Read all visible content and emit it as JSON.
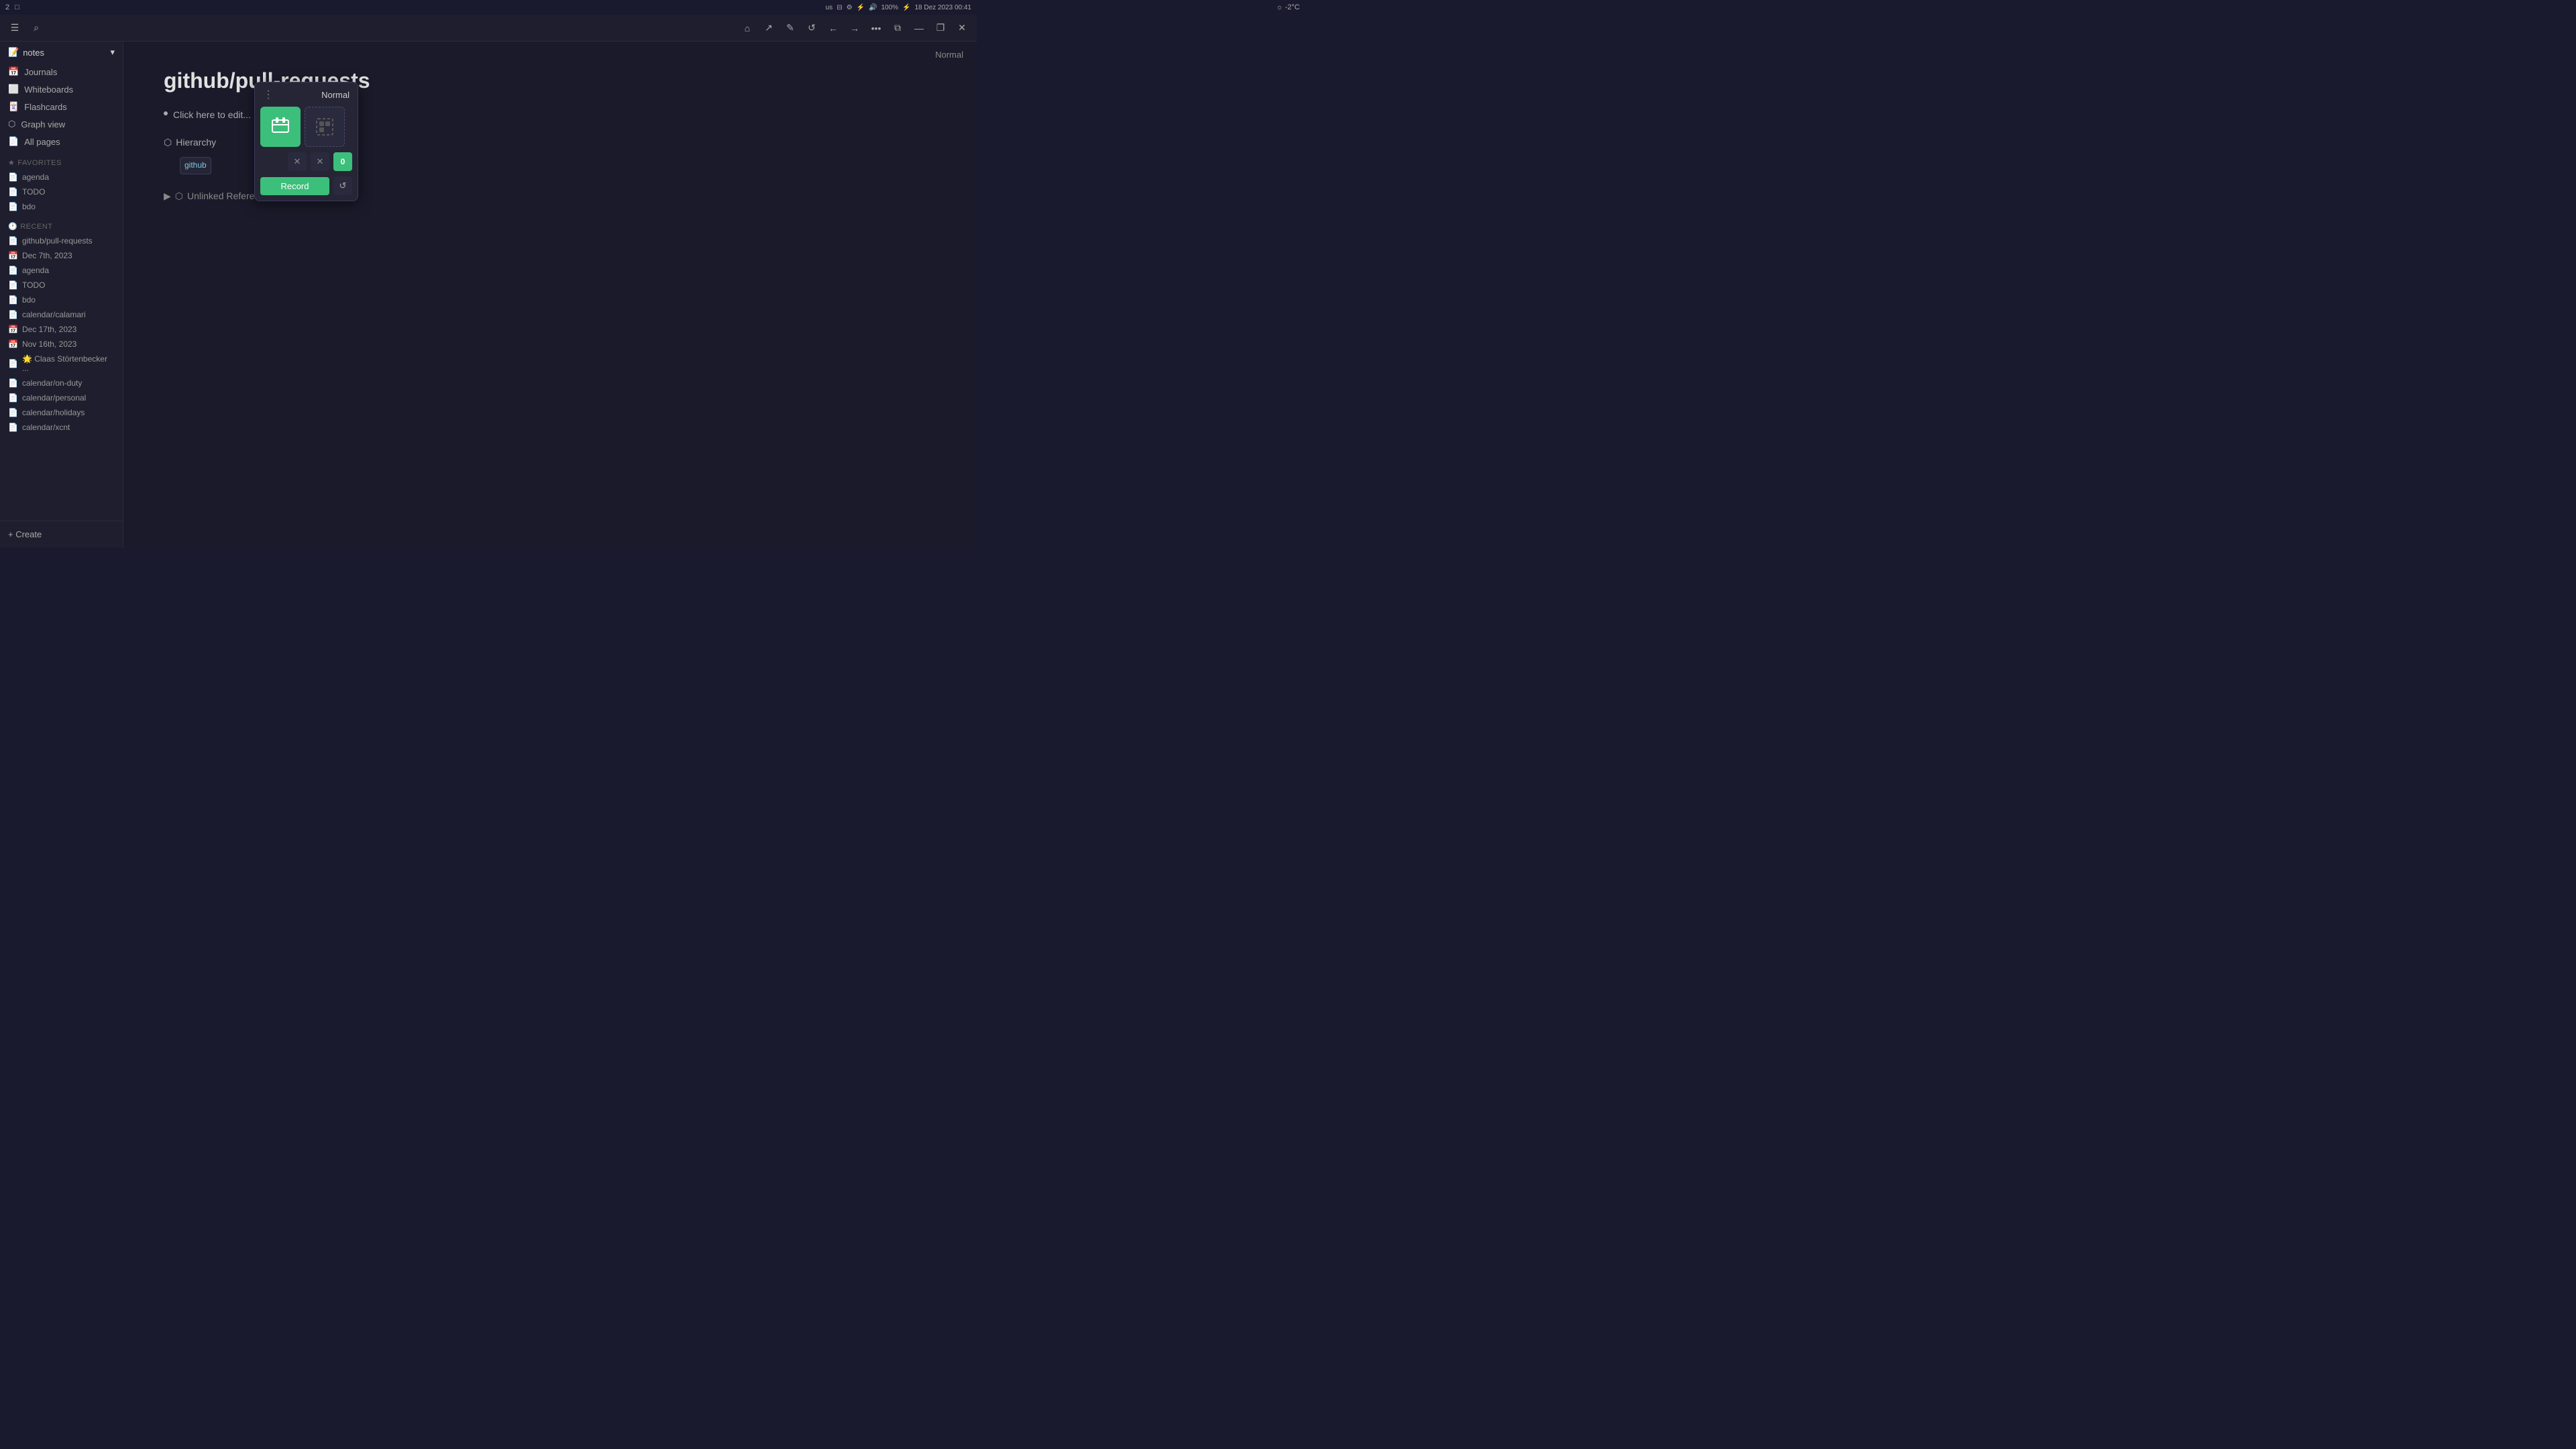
{
  "system_bar": {
    "workspace_num": "2",
    "weather": "☼ -2°C",
    "time": "18 Dez 2023  00:41",
    "lang": "us",
    "volume": "100%"
  },
  "toolbar": {
    "menu_icon": "☰",
    "search_icon": "🔍",
    "nav_buttons": [
      "⌂",
      "↗",
      "✏",
      "↺",
      "←",
      "→",
      "•••",
      "⧉"
    ],
    "window_controls": [
      "—",
      "❐",
      "✕"
    ]
  },
  "sidebar": {
    "workspace_label": "notes",
    "nav_items": [
      {
        "label": "Journals",
        "icon": "📅"
      },
      {
        "label": "Whiteboards",
        "icon": "⬜"
      },
      {
        "label": "Flashcards",
        "icon": "🃏"
      },
      {
        "label": "Graph view",
        "icon": "⬡"
      },
      {
        "label": "All pages",
        "icon": "📄"
      }
    ],
    "favorites_label": "FAVORITES",
    "favorites_icon": "★",
    "favorites": [
      {
        "label": "agenda",
        "icon": "📄"
      },
      {
        "label": "TODO",
        "icon": "📄"
      },
      {
        "label": "bdo",
        "icon": "📄"
      }
    ],
    "recent_label": "RECENT",
    "recent_icon": "🕐",
    "recent": [
      {
        "label": "github/pull-requests",
        "icon": "📄"
      },
      {
        "label": "Dec 7th, 2023",
        "icon": "📅"
      },
      {
        "label": "agenda",
        "icon": "📄"
      },
      {
        "label": "TODO",
        "icon": "📄"
      },
      {
        "label": "bdo",
        "icon": "📄"
      },
      {
        "label": "calendar/calamari",
        "icon": "📄"
      },
      {
        "label": "Dec 17th, 2023",
        "icon": "📅"
      },
      {
        "label": "Nov 16th, 2023",
        "icon": "📅"
      },
      {
        "label": "🌟 Claas Störtenbecker ...",
        "icon": "📄"
      },
      {
        "label": "calendar/on-duty",
        "icon": "📄"
      },
      {
        "label": "calendar/personal",
        "icon": "📄"
      },
      {
        "label": "calendar/holidays",
        "icon": "📄"
      },
      {
        "label": "calendar/xcnt",
        "icon": "📄"
      }
    ],
    "create_label": "+ Create"
  },
  "popup": {
    "title": "Normal",
    "more_icon": "⋮",
    "icon1_symbol": "⊞",
    "icon2_symbol": "⊟",
    "tool1_symbol": "✕",
    "tool2_symbol": "✕",
    "count": "0",
    "record_label": "Record",
    "refresh_icon": "↺"
  },
  "main": {
    "page_title": "github/pull-requests",
    "normal_badge": "Normal",
    "edit_placeholder": "Click here to edit...",
    "hierarchy_label": "Hierarchy",
    "hierarchy_icon": "⬡",
    "hierarchy_link": "github",
    "unlinked_refs_label": "Unlinked References",
    "unlinked_refs_icon": "⬡"
  }
}
